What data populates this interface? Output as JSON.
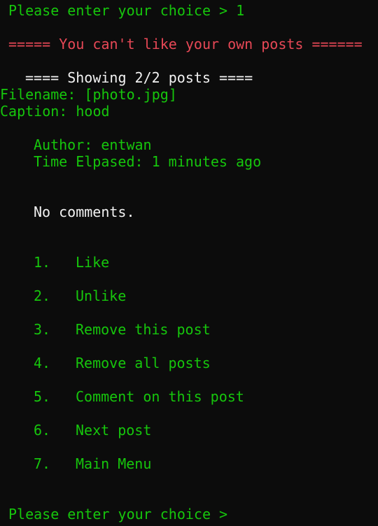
{
  "terminal": {
    "prompt_top": "Please enter your choice > 1",
    "error": "===== You can't like your own posts ======",
    "showing_header": "==== Showing 2/2 posts ====",
    "filename": "Filename: [photo.jpg]",
    "caption": "Caption: hood",
    "author": "Author: entwan",
    "time_elapsed": "Time Elpased: 1 minutes ago",
    "comments": "No comments.",
    "menu": [
      {
        "number": "1.",
        "label": "Like"
      },
      {
        "number": "2.",
        "label": "Unlike"
      },
      {
        "number": "3.",
        "label": "Remove this post"
      },
      {
        "number": "4.",
        "label": "Remove all posts"
      },
      {
        "number": "5.",
        "label": "Comment on this post"
      },
      {
        "number": "6.",
        "label": "Next post"
      },
      {
        "number": "7.",
        "label": "Main Menu"
      }
    ],
    "prompt_bottom": "Please enter your choice >",
    "colors": {
      "background": "#0c0c0c",
      "green": "#16c60c",
      "red": "#e74856",
      "white": "#f2f2f2"
    }
  }
}
